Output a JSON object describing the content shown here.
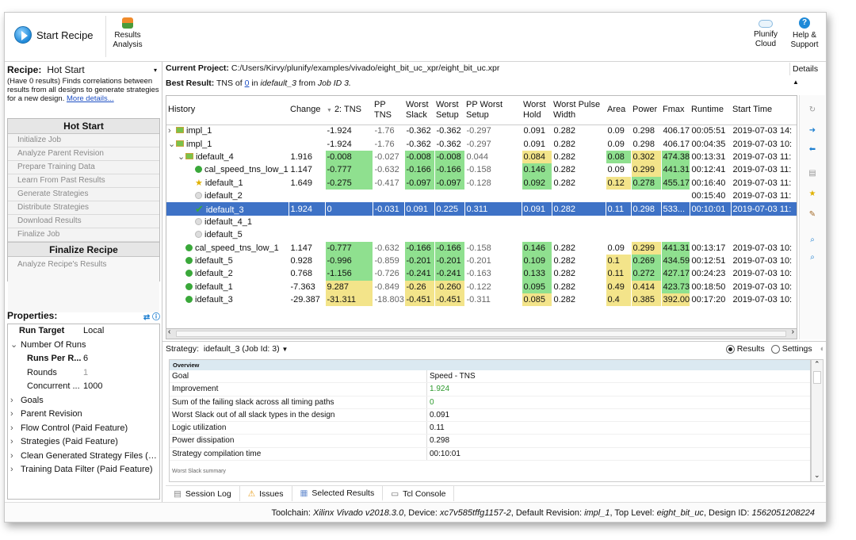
{
  "toolbar": {
    "start_recipe": "Start Recipe",
    "results_analysis_line1": "Results",
    "results_analysis_line2": "Analysis",
    "plunify_cloud_line1": "Plunify",
    "plunify_cloud_line2": "Cloud",
    "help_line1": "Help &",
    "help_line2": "Support"
  },
  "recipe": {
    "label": "Recipe:",
    "value": "Hot Start",
    "description": "(Have 0 results) Finds correlations between results from all designs to generate strategies for a new design.",
    "more_link": "More details..."
  },
  "steps": {
    "header": "Hot Start",
    "items": [
      "Initialize Job",
      "Analyze Parent Revision",
      "Prepare Training Data",
      "Learn From Past Results",
      "Generate Strategies",
      "Distribute Strategies",
      "Download Results",
      "Finalize Job"
    ],
    "finalize_header": "Finalize Recipe",
    "finalize_item": "Analyze Recipe's Results"
  },
  "properties": {
    "title": "Properties:",
    "rows": [
      {
        "key": "Run Target",
        "value": "Local",
        "bold": true,
        "indent": 1
      },
      {
        "key": "Number Of Runs",
        "value": "",
        "expand": "v",
        "indent": 0
      },
      {
        "key": "Runs Per R...",
        "value": "6",
        "bold": true,
        "indent": 2
      },
      {
        "key": "Rounds",
        "value": "1",
        "dim": true,
        "indent": 2
      },
      {
        "key": "Concurrent ...",
        "value": "1000",
        "indent": 2
      },
      {
        "key": "Goals",
        "value": "",
        "expand": ">",
        "indent": 0
      },
      {
        "key": "Parent Revision",
        "value": "",
        "expand": ">",
        "indent": 0
      },
      {
        "key": "Flow Control (Paid Feature)",
        "value": "",
        "expand": ">",
        "indent": 0
      },
      {
        "key": "Strategies (Paid Feature)",
        "value": "",
        "expand": ">",
        "indent": 0
      },
      {
        "key": "Clean Generated Strategy Files (Pa...",
        "value": "",
        "expand": ">",
        "indent": 0
      },
      {
        "key": "Training Data Filter (Paid Feature)",
        "value": "",
        "expand": ">",
        "indent": 0
      }
    ]
  },
  "project": {
    "label": "Current Project:",
    "path": "C:/Users/Kirvy/plunify/examples/vivado/eight_bit_uc_xpr/eight_bit_uc.xpr",
    "best_label": "Best Result:",
    "best_text1": "TNS of",
    "best_link": "0",
    "best_text2": "in",
    "best_item": "idefault_3",
    "best_text3": "from",
    "best_job": "Job ID 3."
  },
  "details_button": "Details",
  "grid": {
    "headers": [
      "History",
      "Change",
      "2: TNS",
      "PP TNS",
      "Worst Slack",
      "Worst Setup",
      "PP Worst Setup",
      "Worst Hold",
      "Worst Pulse Width",
      "Area",
      "Power",
      "Fmax",
      "Runtime",
      "Start Time"
    ],
    "sort_glyph": "▼",
    "rows": [
      {
        "tree": ">",
        "indent": 0,
        "icon": "impl",
        "name": "impl_1",
        "cells": [
          "",
          "-1.924",
          "-1.76",
          "-0.362",
          "-0.362",
          "-0.297",
          "0.091",
          "0.282",
          "0.09",
          "0.298",
          "406.17",
          "00:05:51",
          "2019-07-03 14:"
        ],
        "colors": {}
      },
      {
        "tree": "v",
        "indent": 0,
        "icon": "impl",
        "name": "impl_1",
        "cells": [
          "",
          "-1.924",
          "-1.76",
          "-0.362",
          "-0.362",
          "-0.297",
          "0.091",
          "0.282",
          "0.09",
          "0.298",
          "406.17",
          "00:04:35",
          "2019-07-03 10:"
        ],
        "colors": {}
      },
      {
        "tree": "v",
        "indent": 1,
        "icon": "impl",
        "name": "idefault_4",
        "cells": [
          "1.916",
          "-0.008",
          "-0.027",
          "-0.008",
          "-0.008",
          "0.044",
          "0.084",
          "0.282",
          "0.08",
          "0.302",
          "474.38",
          "00:13:31",
          "2019-07-03 11:"
        ],
        "colors": {
          "1": "g",
          "3": "g",
          "4": "g",
          "6": "y",
          "8": "g",
          "9": "y",
          "10": "g"
        }
      },
      {
        "tree": "",
        "indent": 2,
        "icon": "dot",
        "name": "cal_speed_tns_low_1",
        "cells": [
          "1.147",
          "-0.777",
          "-0.632",
          "-0.166",
          "-0.166",
          "-0.158",
          "0.146",
          "0.282",
          "0.09",
          "0.299",
          "441.31",
          "00:12:41",
          "2019-07-03 11:"
        ],
        "colors": {
          "1": "g",
          "3": "g",
          "4": "g",
          "6": "g",
          "9": "y",
          "10": "g"
        }
      },
      {
        "tree": "",
        "indent": 2,
        "icon": "star",
        "name": "idefault_1",
        "cells": [
          "1.649",
          "-0.275",
          "-0.417",
          "-0.097",
          "-0.097",
          "-0.128",
          "0.092",
          "0.282",
          "0.12",
          "0.278",
          "455.17",
          "00:16:40",
          "2019-07-03 11:"
        ],
        "colors": {
          "1": "g",
          "3": "g",
          "4": "g",
          "6": "g",
          "8": "y",
          "9": "g",
          "10": "g"
        }
      },
      {
        "tree": "",
        "indent": 2,
        "icon": "grey",
        "name": "idefault_2",
        "cells": [
          "",
          "",
          "",
          "",
          "",
          "",
          "",
          "",
          "",
          "",
          "",
          "00:15:40",
          "2019-07-03 11:"
        ],
        "colors": {}
      },
      {
        "tree": "",
        "indent": 2,
        "icon": "check",
        "name": "idefault_3",
        "cells": [
          "1.924",
          "0",
          "-0.031",
          "0.091",
          "0.225",
          "0.311",
          "0.091",
          "0.282",
          "0.11",
          "0.298",
          "533...",
          "00:10:01",
          "2019-07-03 11:"
        ],
        "colors": {},
        "selected": true
      },
      {
        "tree": "",
        "indent": 2,
        "icon": "grey",
        "name": "idefault_4_1",
        "cells": [
          "",
          "",
          "",
          "",
          "",
          "",
          "",
          "",
          "",
          "",
          "",
          "",
          ""
        ],
        "colors": {}
      },
      {
        "tree": "",
        "indent": 2,
        "icon": "grey",
        "name": "idefault_5",
        "cells": [
          "",
          "",
          "",
          "",
          "",
          "",
          "",
          "",
          "",
          "",
          "",
          "",
          ""
        ],
        "colors": {}
      },
      {
        "tree": "",
        "indent": 1,
        "icon": "dot",
        "name": "cal_speed_tns_low_1",
        "cells": [
          "1.147",
          "-0.777",
          "-0.632",
          "-0.166",
          "-0.166",
          "-0.158",
          "0.146",
          "0.282",
          "0.09",
          "0.299",
          "441.31",
          "00:13:17",
          "2019-07-03 10:"
        ],
        "colors": {
          "1": "g",
          "3": "g",
          "4": "g",
          "6": "g",
          "9": "y",
          "10": "g"
        }
      },
      {
        "tree": "",
        "indent": 1,
        "icon": "dot",
        "name": "idefault_5",
        "cells": [
          "0.928",
          "-0.996",
          "-0.859",
          "-0.201",
          "-0.201",
          "-0.201",
          "0.109",
          "0.282",
          "0.1",
          "0.269",
          "434.59",
          "00:12:51",
          "2019-07-03 10:"
        ],
        "colors": {
          "1": "g",
          "3": "g",
          "4": "g",
          "6": "g",
          "8": "y",
          "9": "g",
          "10": "g"
        }
      },
      {
        "tree": "",
        "indent": 1,
        "icon": "dot",
        "name": "idefault_2",
        "cells": [
          "0.768",
          "-1.156",
          "-0.726",
          "-0.241",
          "-0.241",
          "-0.163",
          "0.133",
          "0.282",
          "0.11",
          "0.272",
          "427.17",
          "00:24:23",
          "2019-07-03 10:"
        ],
        "colors": {
          "1": "g",
          "3": "g",
          "4": "g",
          "6": "g",
          "8": "y",
          "9": "g",
          "10": "g"
        }
      },
      {
        "tree": "",
        "indent": 1,
        "icon": "dot",
        "name": "idefault_1",
        "cells": [
          "-7.363",
          "9.287",
          "-0.849",
          "-0.26",
          "-0.260",
          "-0.122",
          "0.095",
          "0.282",
          "0.49",
          "0.414",
          "423.73",
          "00:18:50",
          "2019-07-03 10:"
        ],
        "colors": {
          "1": "y",
          "3": "y",
          "4": "y",
          "6": "g",
          "8": "y",
          "9": "y",
          "10": "g"
        }
      },
      {
        "tree": "",
        "indent": 1,
        "icon": "dot",
        "name": "idefault_3",
        "cells": [
          "-29.387",
          "-31.311",
          "-18.803",
          "-0.451",
          "-0.451",
          "-0.311",
          "0.085",
          "0.282",
          "0.4",
          "0.385",
          "392.00",
          "00:17:20",
          "2019-07-03 10:"
        ],
        "colors": {
          "1": "y",
          "3": "y",
          "4": "y",
          "6": "y",
          "8": "y",
          "9": "y",
          "10": "y"
        }
      }
    ]
  },
  "strategy": {
    "label": "Strategy:",
    "value": "idefault_3 (Job Id: 3)",
    "results": "Results",
    "settings": "Settings"
  },
  "overview": {
    "header": "Overview",
    "rows": [
      {
        "k": "Goal",
        "v": "Speed - TNS",
        "green": false
      },
      {
        "k": "Improvement",
        "v": "1.924",
        "green": true
      },
      {
        "k": "Sum of the failing slack across all timing paths",
        "v": "0",
        "green": true
      },
      {
        "k": "Worst Slack out of all slack types in the design",
        "v": "0.091",
        "green": false
      },
      {
        "k": "Logic utilization",
        "v": "0.11",
        "green": false
      },
      {
        "k": "Power dissipation",
        "v": "0.298",
        "green": false
      },
      {
        "k": "Strategy compilation time",
        "v": "00:10:01",
        "green": false
      }
    ],
    "cut_label": "Worst Slack summary"
  },
  "tabs": [
    "Session Log",
    "Issues",
    "Selected Results",
    "Tcl Console"
  ],
  "status": {
    "t1": "Toolchain: ",
    "toolchain": "Xilinx Vivado v2018.3.0",
    "t2": ", Device: ",
    "device": "xc7v585tffg1157-2",
    "t3": ", Default Revision: ",
    "revision": "impl_1",
    "t4": ", Top Level: ",
    "top": "eight_bit_uc",
    "t5": ", Design ID: ",
    "design_id": "1562051208224"
  },
  "colors": {
    "green": "#8fe08f",
    "yellow": "#f3e48a",
    "selection": "#3e72c6",
    "link": "#1d4fc4"
  }
}
